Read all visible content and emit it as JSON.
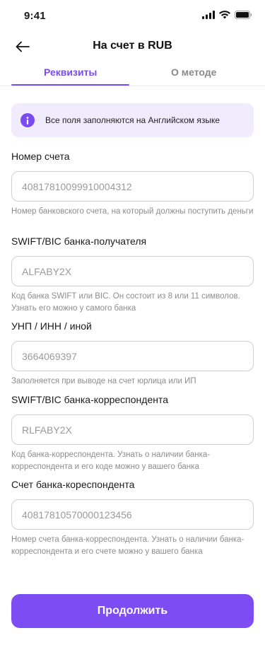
{
  "status_bar": {
    "time": "9:41"
  },
  "header": {
    "title": "На счет в RUB"
  },
  "tabs": [
    {
      "label": "Реквизиты"
    },
    {
      "label": "О методе"
    }
  ],
  "notice": {
    "text": "Все поля заполняются на Английском языке"
  },
  "fields": [
    {
      "label": "Номер счета",
      "value": "40817810099910004312",
      "hint": "Номер банковского счета, на который должны поступить деньги"
    },
    {
      "label": "SWIFT/BIC банка-получателя",
      "value": "ALFABY2X",
      "hint": "Код банка SWIFT или BIC. Он состоит из 8 или 11 символов. Узнать его можно у самого банка"
    },
    {
      "label": "УНП / ИНН / иной",
      "value": "3664069397",
      "hint": "Заполняется при выводе на счет юрлица или ИП"
    },
    {
      "label": "SWIFT/BIC банка-корреспондента",
      "value": "RLFABY2X",
      "hint": "Код банка-корреспондента. Узнать о наличии банка-корреспондента и его коде можно у вашего банка"
    },
    {
      "label": "Счет банка-кореспондента",
      "value": "40817810570000123456",
      "hint": "Номер счета банка-корреспондента. Узнать о наличии банка-корреспондента и его счете можно у вашего банка"
    }
  ],
  "continue_button": {
    "label": "Продолжить"
  },
  "colors": {
    "accent": "#7a4bf0",
    "notice_bg": "#f1ecfd",
    "button": "#7d4cf2"
  },
  "icons": [
    "back-arrow-icon",
    "info-icon",
    "signal-icon",
    "wifi-icon",
    "battery-icon"
  ]
}
